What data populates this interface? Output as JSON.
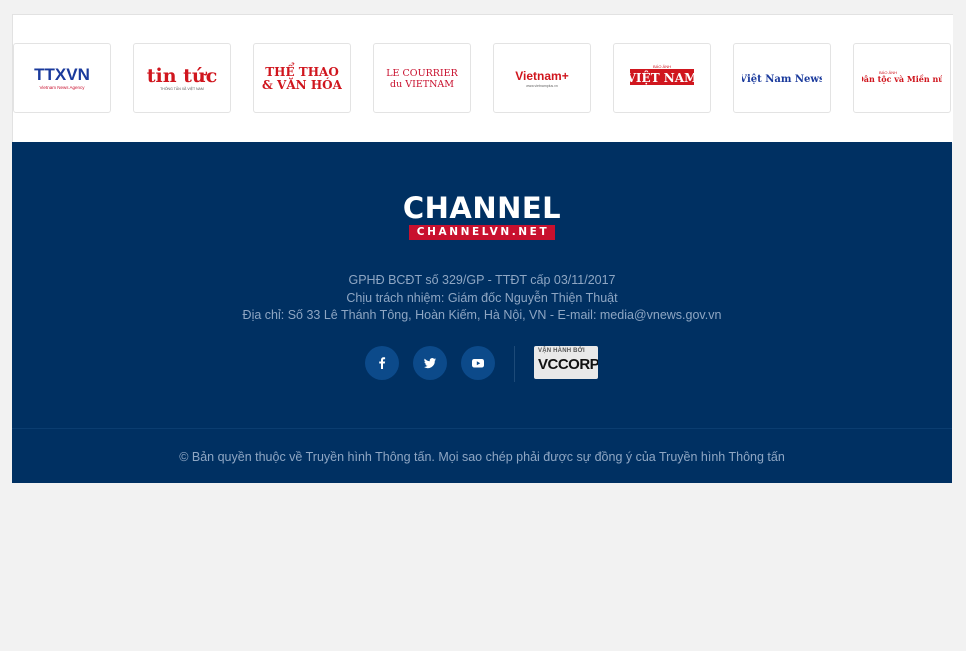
{
  "partners": [
    {
      "name": "TTXVN",
      "sub": "Vietnam News Agency"
    },
    {
      "name": "tin tức",
      "sub": "THÔNG TẤN XÃ VIỆT NAM"
    },
    {
      "name": "THỂ THAO",
      "name2": "& VĂN HÓA"
    },
    {
      "name": "LE COURRIER",
      "name2": "du VIETNAM"
    },
    {
      "name": "Vietnam+",
      "sub": "www.vietnamplus.vn"
    },
    {
      "name": "VIỆT NAM",
      "sub": "BÁO ẢNH"
    },
    {
      "name": "Việt Nam News"
    },
    {
      "name": "Dân tộc và Miền núi",
      "sub": "BÁO ẢNH"
    }
  ],
  "brand": {
    "title": "CHANNEL",
    "subtitle": "CHANNELVN.NET"
  },
  "info": {
    "license": "GPHĐ BCĐT số 329/GP - TTĐT cấp 03/11/2017",
    "responsible": "Chịu trách nhiệm: Giám đốc Nguyễn Thiện Thuật",
    "address": "Địa chỉ: Số 33 Lê Thánh Tông, Hoàn Kiếm, Hà Nội, VN - E-mail: ",
    "email": "media@vnews.gov.vn"
  },
  "social": [
    {
      "icon": "facebook-icon",
      "glyph": "f"
    },
    {
      "icon": "twitter-icon"
    },
    {
      "icon": "youtube-icon"
    }
  ],
  "operator": {
    "label": "VẬN HÀNH BỞI",
    "name": "VCCORP"
  },
  "copyright": "© Bản quyền thuộc về Truyền hình Thông tấn. Mọi sao chép phải được sự đồng ý của Truyền hình Thông tấn",
  "colors": {
    "footer_bg": "#003062",
    "accent_red": "#c8102e",
    "social_bg": "#0c4a8a",
    "text": "#8ea6c3"
  }
}
